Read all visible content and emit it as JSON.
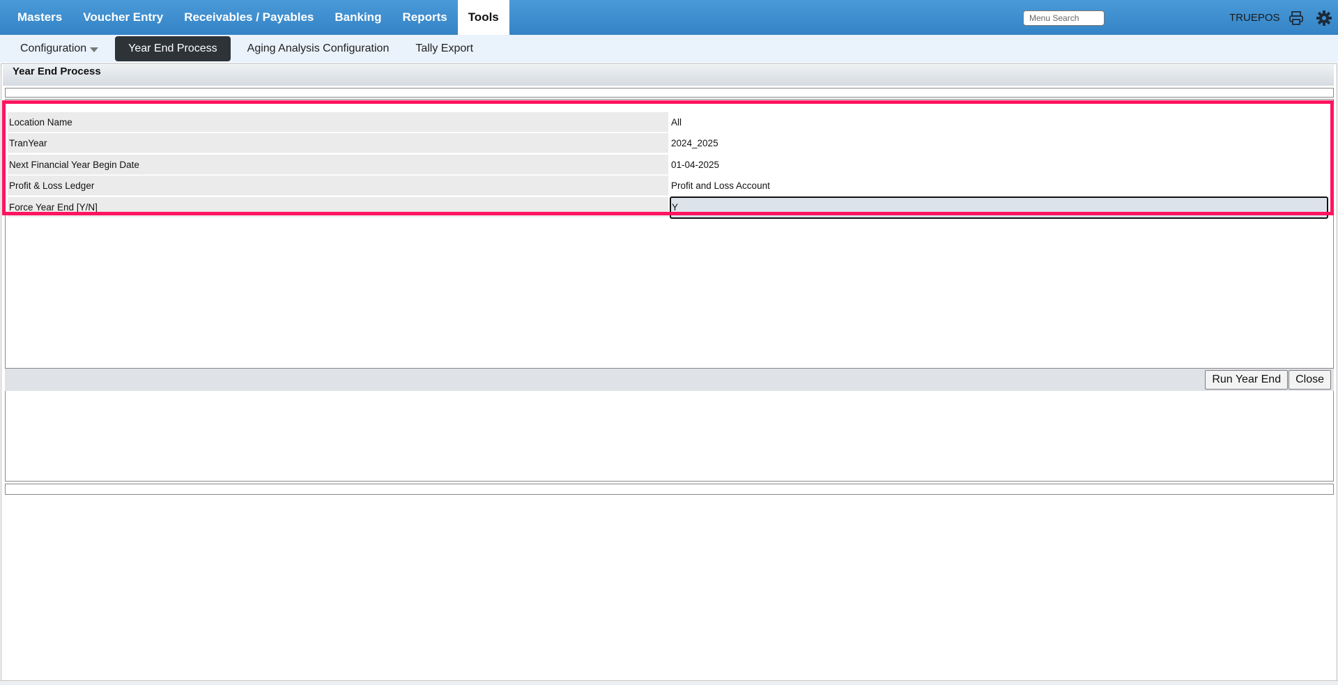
{
  "nav": {
    "items": [
      {
        "label": "Masters",
        "active": false
      },
      {
        "label": "Voucher Entry",
        "active": false
      },
      {
        "label": "Receivables / Payables",
        "active": false
      },
      {
        "label": "Banking",
        "active": false
      },
      {
        "label": "Reports",
        "active": false
      },
      {
        "label": "Tools",
        "active": true
      }
    ],
    "search_placeholder": "Menu Search",
    "user": "TRUEPOS"
  },
  "subnav": {
    "configuration": "Configuration",
    "year_end": "Year End Process",
    "aging": "Aging Analysis Configuration",
    "tally": "Tally Export"
  },
  "panel": {
    "title": "Year End Process",
    "fields": [
      {
        "label": "Location Name",
        "value": "All"
      },
      {
        "label": "TranYear",
        "value": "2024_2025"
      },
      {
        "label": "Next Financial Year Begin Date",
        "value": "01-04-2025"
      },
      {
        "label": "Profit & Loss Ledger",
        "value": "Profit and Loss Account"
      },
      {
        "label": "Force Year End [Y/N]",
        "value": "Y"
      }
    ],
    "run_button": "Run Year End",
    "close_button": "Close"
  },
  "colors": {
    "nav_bg": "#3d8ccf",
    "highlight": "#ff1460",
    "active_sub": "#2e3338"
  }
}
